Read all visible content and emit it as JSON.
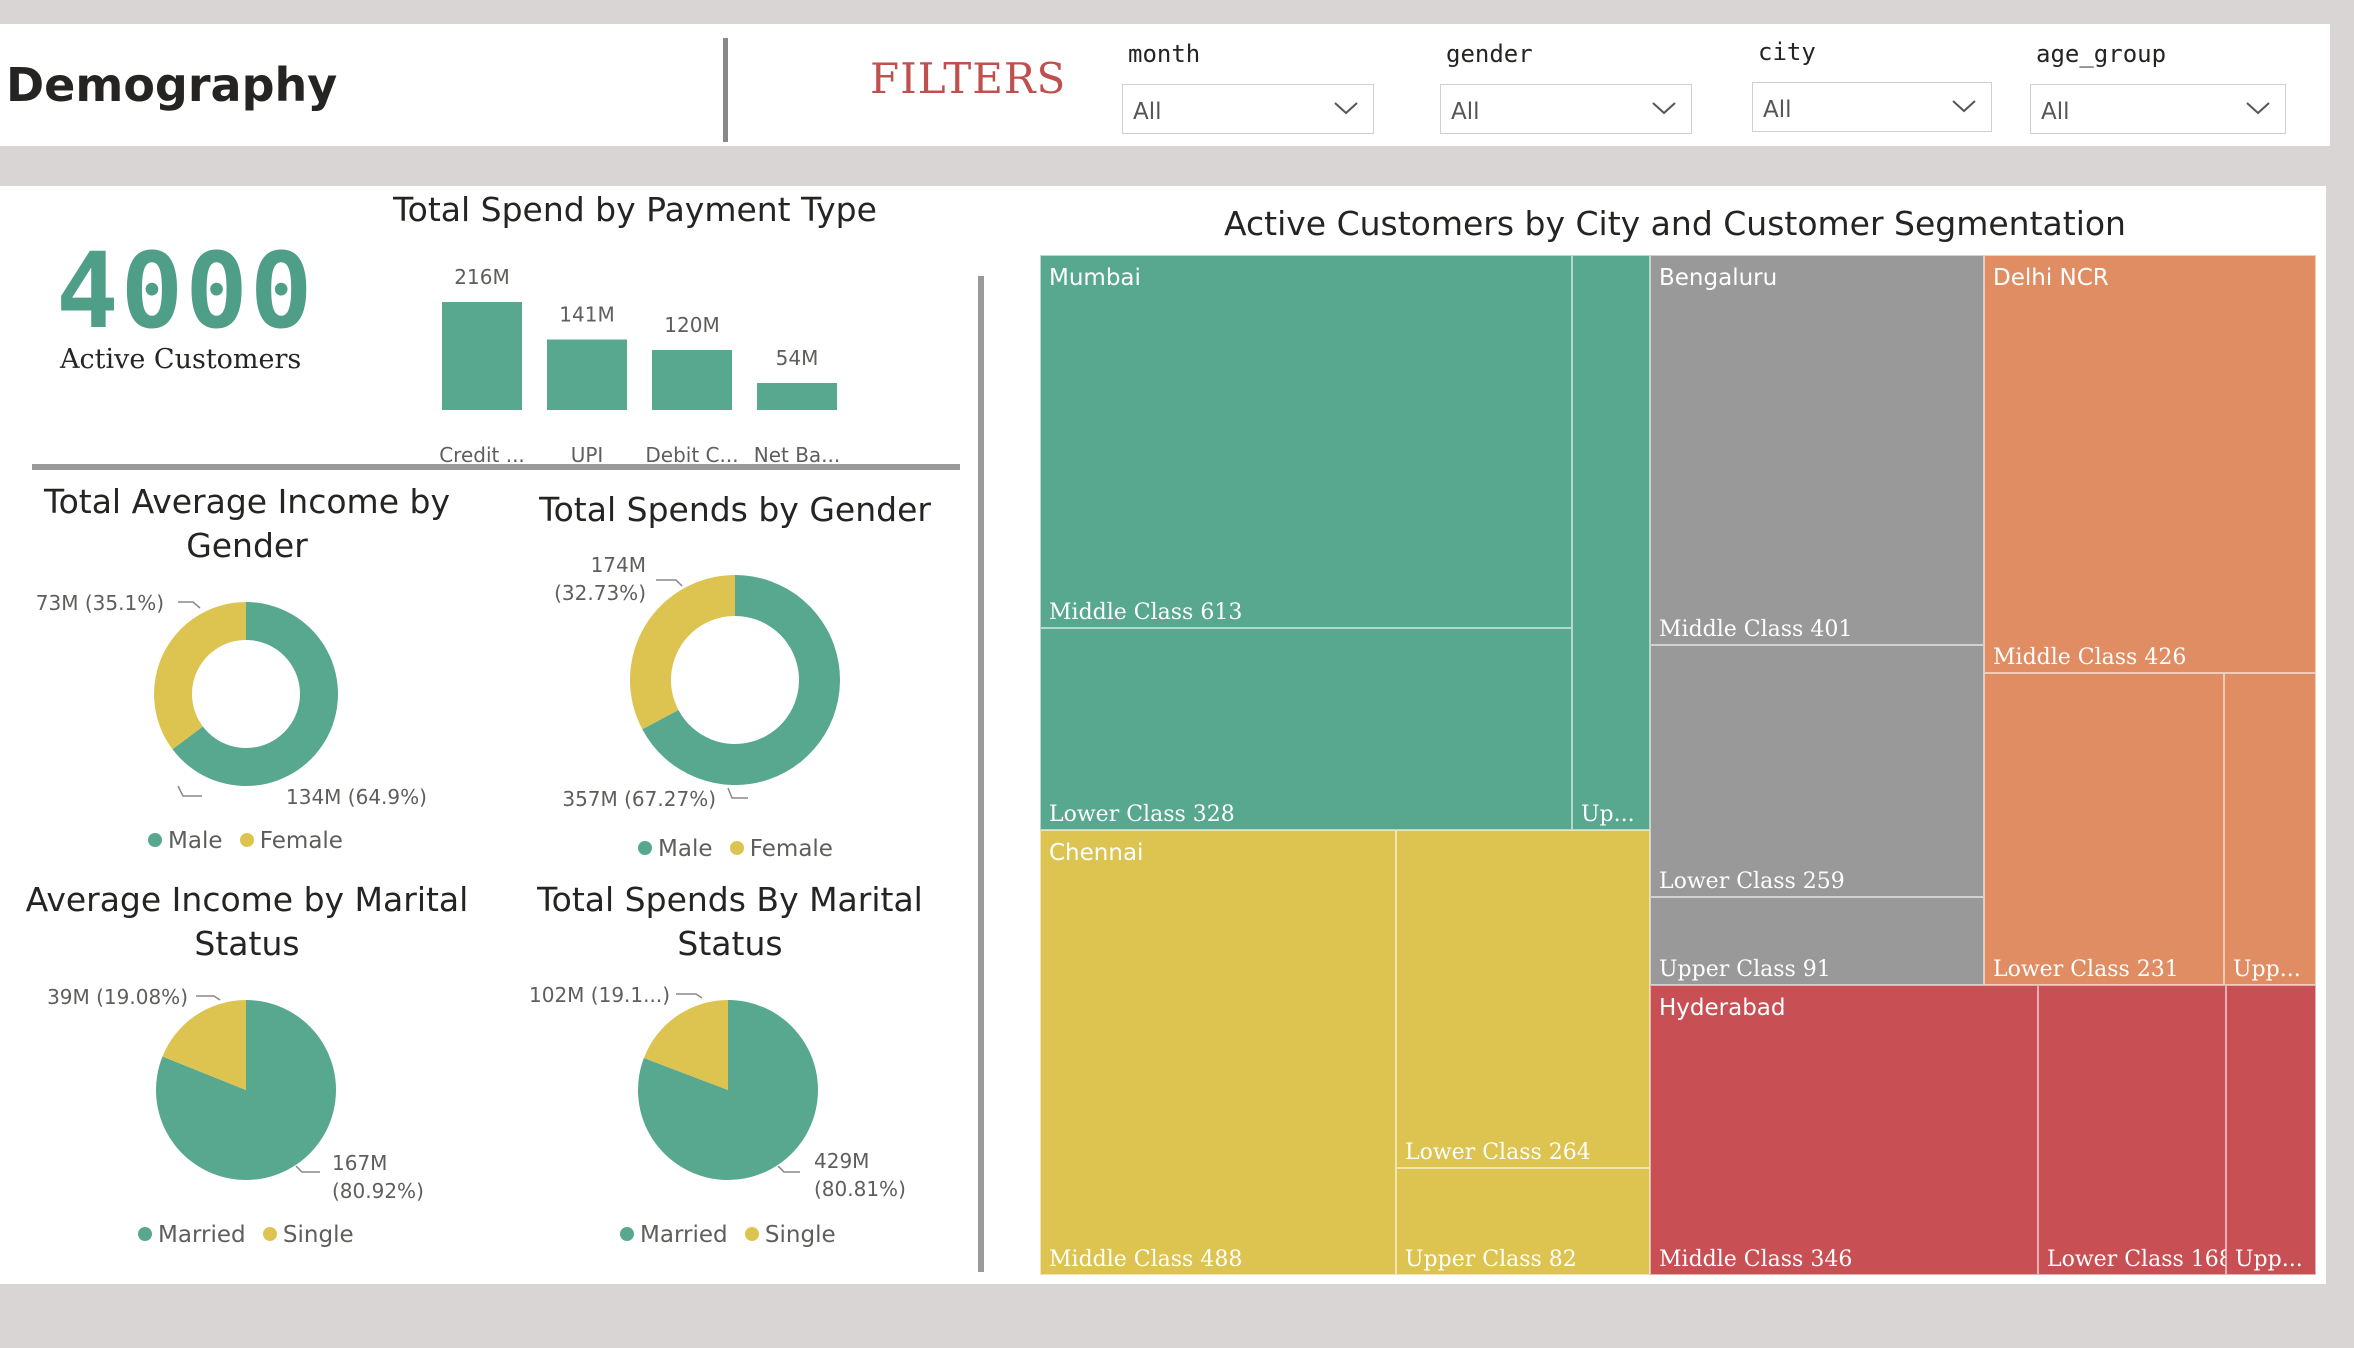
{
  "page": {
    "title": "Demography",
    "filters_title": "FILTERS"
  },
  "slicers": [
    {
      "label": "month",
      "value": "All"
    },
    {
      "label": "gender",
      "value": "All"
    },
    {
      "label": "city",
      "value": "All"
    },
    {
      "label": "age_group",
      "value": "All"
    }
  ],
  "kpi": {
    "value": "4000",
    "label": "Active Customers"
  },
  "colors": {
    "accent": "#57a88f",
    "secondary": "#ddc451",
    "gray": "#999999",
    "orange": "#e08d63",
    "red": "#c85054"
  },
  "chart_data": [
    {
      "type": "bar",
      "title": "Total Spend by Payment Type",
      "categories": [
        "Credit ...",
        "UPI",
        "Debit C...",
        "Net Ba..."
      ],
      "values": [
        216,
        141,
        120,
        54
      ],
      "data_labels": [
        "216M",
        "141M",
        "120M",
        "54M"
      ],
      "ylim": [
        0,
        216
      ]
    },
    {
      "type": "pie",
      "variant": "donut",
      "title_lines": [
        "Total Average Income by",
        "Gender"
      ],
      "labels": [
        "Male",
        "Female"
      ],
      "values": [
        134,
        73
      ],
      "data_labels": [
        "134M (64.9%)",
        "73M (35.1%)"
      ],
      "legend": [
        "Male",
        "Female"
      ]
    },
    {
      "type": "pie",
      "variant": "donut",
      "title_lines": [
        "Total Spends by Gender"
      ],
      "labels": [
        "Male",
        "Female"
      ],
      "values": [
        357,
        174
      ],
      "data_labels": [
        "357M (67.27%)",
        "174M",
        "(32.73%)"
      ],
      "legend": [
        "Male",
        "Female"
      ]
    },
    {
      "type": "pie",
      "title_lines": [
        "Average Income by Marital",
        "Status"
      ],
      "labels": [
        "Married",
        "Single"
      ],
      "values": [
        167,
        39
      ],
      "data_labels": [
        "167M",
        "(80.92%)",
        "39M (19.08%)"
      ],
      "legend": [
        "Married",
        "Single"
      ]
    },
    {
      "type": "pie",
      "title_lines": [
        "Total Spends By Marital",
        "Status"
      ],
      "labels": [
        "Married",
        "Single"
      ],
      "values": [
        429,
        102
      ],
      "data_labels": [
        "429M",
        "(80.81%)",
        "102M (19.1...)"
      ],
      "legend": [
        "Married",
        "Single"
      ]
    },
    {
      "type": "treemap",
      "title": "Active Customers by City and Customer Segmentation",
      "groups": [
        {
          "city": "Mumbai",
          "segments": [
            {
              "label": "Middle Class 613",
              "value": 613
            },
            {
              "label": "Lower Class 328",
              "value": 328
            },
            {
              "label": "Up...",
              "value": 0
            }
          ]
        },
        {
          "city": "Bengaluru",
          "segments": [
            {
              "label": "Middle Class 401",
              "value": 401
            },
            {
              "label": "Lower Class 259",
              "value": 259
            },
            {
              "label": "Upper Class 91",
              "value": 91
            }
          ]
        },
        {
          "city": "Delhi NCR",
          "segments": [
            {
              "label": "Middle Class 426",
              "value": 426
            },
            {
              "label": "Lower Class 231",
              "value": 231
            },
            {
              "label": "Upp...",
              "value": 0
            }
          ]
        },
        {
          "city": "Chennai",
          "segments": [
            {
              "label": "Middle Class 488",
              "value": 488
            },
            {
              "label": "Lower Class 264",
              "value": 264
            },
            {
              "label": "Upper Class 82",
              "value": 82
            }
          ]
        },
        {
          "city": "Hyderabad",
          "segments": [
            {
              "label": "Middle Class 346",
              "value": 346
            },
            {
              "label": "Lower Class 168",
              "value": 168
            },
            {
              "label": "Upp...",
              "value": 0
            }
          ]
        }
      ]
    }
  ]
}
